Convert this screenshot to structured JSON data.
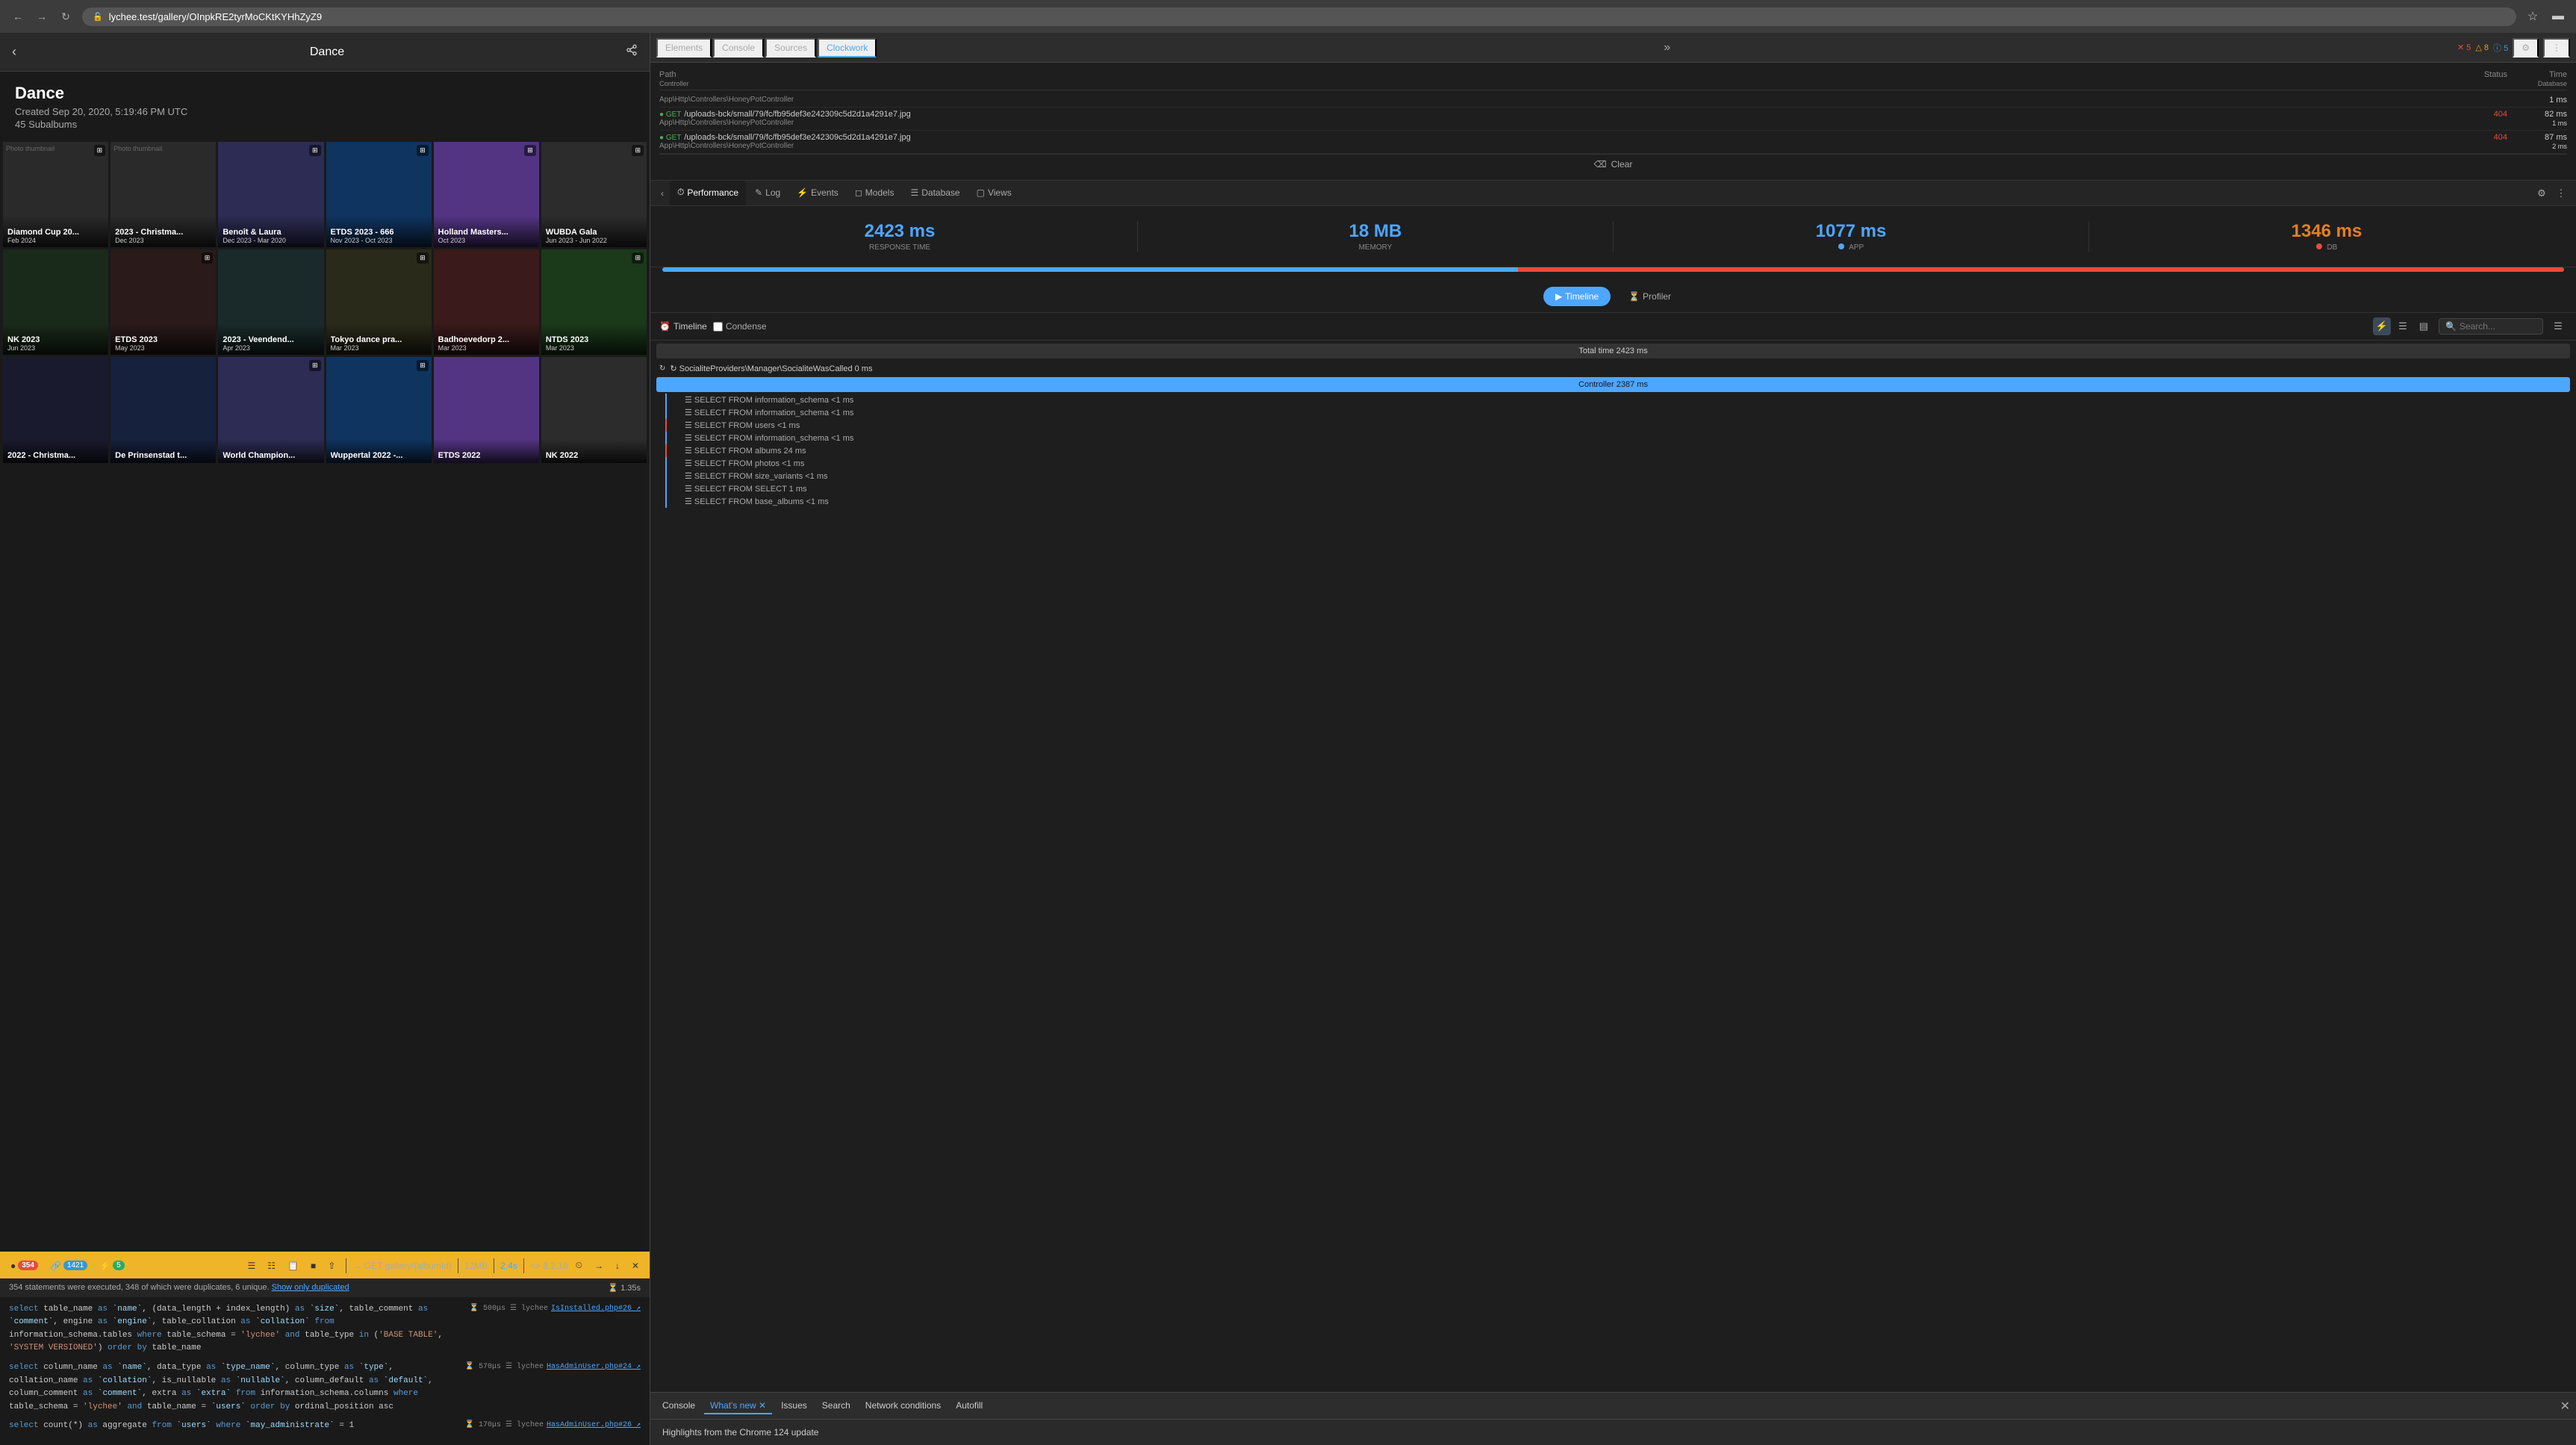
{
  "browser": {
    "url": "lychee.test/gallery/OInpkRE2tyrMoCKtKYHhZyZ9",
    "tab_label": "Dance"
  },
  "gallery": {
    "title": "Dance",
    "back_label": "‹",
    "created": "Created Sep 20, 2020, 5:19:46 PM UTC",
    "subalbums": "45 Subalbums",
    "photos": [
      {
        "name": "Diamond Cup 20...",
        "date": "Feb 2024",
        "has_icon": true
      },
      {
        "name": "2023 - Christma...",
        "date": "Dec 2023",
        "has_icon": false
      },
      {
        "name": "Benoît & Laura",
        "date": "Dec 2023 - Mar 2020",
        "has_icon": true
      },
      {
        "name": "ETDS 2023 - 666",
        "date": "Nov 2023 - Oct 2023",
        "has_icon": true
      },
      {
        "name": "Holland Masters...",
        "date": "Oct 2023",
        "has_icon": true
      },
      {
        "name": "WUBDA Gala",
        "date": "Jun 2023 - Jun 2022",
        "has_icon": true
      },
      {
        "name": "NK 2023",
        "date": "Jun 2023",
        "has_icon": false
      },
      {
        "name": "ETDS 2023",
        "date": "May 2023",
        "has_icon": true
      },
      {
        "name": "2023 - Veendend...",
        "date": "Apr 2023",
        "has_icon": false
      },
      {
        "name": "Tokyo dance pra...",
        "date": "Mar 2023",
        "has_icon": true
      },
      {
        "name": "Badhoevedorp 2...",
        "date": "Mar 2023",
        "has_icon": false
      },
      {
        "name": "NTDS 2023",
        "date": "Mar 2023",
        "has_icon": true
      },
      {
        "name": "2022 - Christma...",
        "date": "",
        "has_icon": false
      },
      {
        "name": "De Prinsenstad t...",
        "date": "",
        "has_icon": false
      },
      {
        "name": "World Champion...",
        "date": "",
        "has_icon": true
      },
      {
        "name": "Wuppertal 2022 -...",
        "date": "",
        "has_icon": true
      },
      {
        "name": "ETDS 2022",
        "date": "",
        "has_icon": false
      },
      {
        "name": "NK 2022",
        "date": "",
        "has_icon": false
      }
    ]
  },
  "devtools": {
    "tabs": [
      "Elements",
      "Console",
      "Sources",
      "Clockwork"
    ],
    "active_tab": "Clockwork",
    "error_count": "5",
    "warning_count": "8",
    "info_count": "5",
    "request_columns": {
      "path": "Path / Controller",
      "status": "Status",
      "time": "Time\nDatabase"
    },
    "requests": [
      {
        "controller": "App\\Http\\Controllers\\HoneyPotController",
        "url": null,
        "status": null,
        "time": "1 ms",
        "db": ""
      },
      {
        "controller": "App\\Http\\Controllers\\HoneyPotController",
        "url": "GET /uploads-bck/small/79/fc/fb95def3e242309c5d2d1a4291e7.jpg",
        "status": "404",
        "time": "82 ms",
        "db": "1 ms"
      },
      {
        "controller": "App\\Http\\Controllers\\HoneyPotController",
        "url": "GET /uploads-bck/small/79/fc/fb95def3e242309c5d2d1a4291e7.jpg",
        "status": "404",
        "time": "87 ms",
        "db": "2 ms"
      }
    ]
  },
  "clockwork": {
    "tabs": [
      "Performance",
      "Log",
      "Events",
      "Models",
      "Database",
      "Views"
    ],
    "active_tab": "Performance",
    "metrics": {
      "response_time": "2423 ms",
      "response_label": "RESPONSE TIME",
      "memory": "18 MB",
      "memory_label": "MEMORY",
      "app_time": "1077 ms",
      "app_label": "APP",
      "db_time": "1346 ms",
      "db_label": "DB"
    },
    "view_toggle": [
      "Timeline",
      "Profiler"
    ],
    "active_view": "Timeline",
    "timeline_label": "Timeline",
    "condense_label": "Condense",
    "total_time": "Total time 2423 ms",
    "timeline_entries": [
      {
        "type": "socialite",
        "text": "↺ SocialiteProviders\\Manager\\SocialiteWasCalled 0 ms",
        "indent": 0
      },
      {
        "type": "controller",
        "text": "Controller 2387 ms",
        "indent": 0
      },
      {
        "type": "sql",
        "text": "SELECT FROM information_schema <1 ms",
        "indent": 1,
        "color": "blue"
      },
      {
        "type": "sql",
        "text": "SELECT FROM information_schema <1 ms",
        "indent": 1,
        "color": "blue"
      },
      {
        "type": "sql",
        "text": "SELECT FROM users <1 ms",
        "indent": 1,
        "color": "red"
      },
      {
        "type": "sql",
        "text": "SELECT FROM information_schema <1 ms",
        "indent": 1,
        "color": "blue"
      },
      {
        "type": "sql",
        "text": "SELECT FROM albums 24 ms",
        "indent": 1,
        "color": "red"
      },
      {
        "type": "sql",
        "text": "SELECT FROM photos <1 ms",
        "indent": 1,
        "color": "blue"
      },
      {
        "type": "sql",
        "text": "SELECT FROM size_variants <1 ms",
        "indent": 1,
        "color": "blue"
      },
      {
        "type": "sql",
        "text": "SELECT FROM SELECT 1 ms",
        "indent": 1,
        "color": "blue"
      },
      {
        "type": "sql",
        "text": "SELECT FROM base_albums <1 ms",
        "indent": 1,
        "color": "blue"
      }
    ]
  },
  "bottom_bar": {
    "url_label": "→ GET gallery/{albumId}",
    "size": "12MB",
    "time": "2.4s",
    "version": "<> 8.2.18",
    "stmt_count": "354",
    "link_count": "1421",
    "lightning_count": "5"
  },
  "sql_panel": {
    "info_text": "354 statements were executed, 348 of which were duplicates, 6 unique.",
    "show_duplicated": "Show only duplicated",
    "time": "1.35s",
    "queries": [
      {
        "code": "select table_name as `name`, (data_length + index_length) as `size`, table_comment as `comment`, engine as `engine`, table_collation as `collation` from information_schema.tables where table_schema = 'lychee' and table_type in ('BASE TABLE', 'SYSTEM VERSIONED') order by table_name",
        "time": "500μs",
        "source": "lychee",
        "file": "IsInstalled.php#26",
        "has_link": true
      },
      {
        "code": "select column_name as `name`, data_type as `type_name`, column_type as `type`, collation_name as `collation`, is_nullable as `nullable`, column_default as `default`, column_comment as `comment`, extra as `extra` from information_schema.columns where table_schema = 'lychee' and table_name = `users` order by ordinal_position asc",
        "time": "570μs",
        "source": "lychee",
        "file": "HasAdminUser.php#24",
        "has_link": true
      },
      {
        "code": "select count(*) as aggregate from `users` where `may_administrate` = 1",
        "time": "170μs",
        "source": "lychee",
        "file": "HasAdminUser.php#26",
        "has_link": true
      }
    ]
  },
  "devtools_bottom": {
    "tabs": [
      "Console",
      "What's new",
      "Issues",
      "Search",
      "Network conditions",
      "Autofill"
    ],
    "active_tab": "What's new",
    "highlights_text": "Highlights from the Chrome 124 update"
  }
}
